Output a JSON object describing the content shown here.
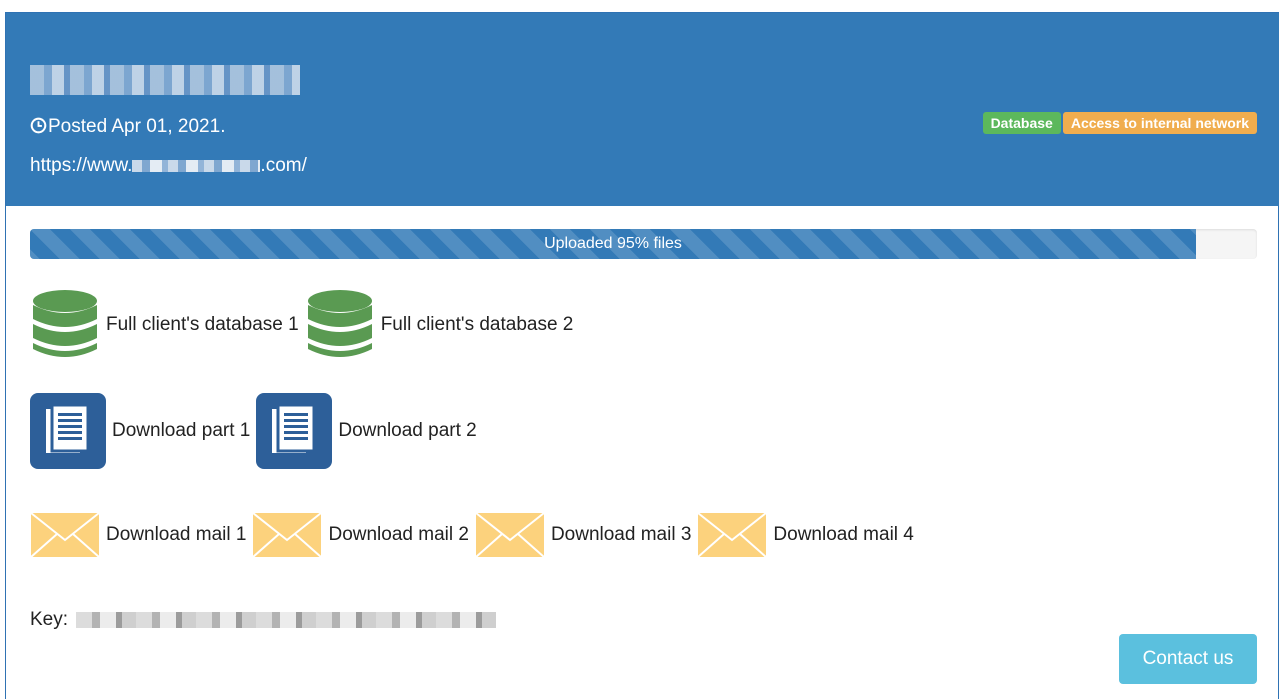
{
  "header": {
    "posted": "Posted Apr 01, 2021.",
    "url_prefix": "https://www.",
    "url_suffix": ".com/",
    "tags": [
      "Database",
      "Access to internal network"
    ],
    "colors": {
      "header_bg": "#337ab7",
      "tag_green": "#5cb85c",
      "tag_orange": "#f0ad4e"
    }
  },
  "progress": {
    "label": "Uploaded 95% files",
    "value_percent": 95
  },
  "databases": [
    {
      "label": "Full client's database 1",
      "icon": "database-icon"
    },
    {
      "label": "Full client's database 2",
      "icon": "database-icon"
    }
  ],
  "downloads": [
    {
      "label": "Download part 1",
      "icon": "document-icon"
    },
    {
      "label": "Download part 2",
      "icon": "document-icon"
    }
  ],
  "mails": [
    {
      "label": "Download mail 1",
      "icon": "mail-icon"
    },
    {
      "label": "Download mail 2",
      "icon": "mail-icon"
    },
    {
      "label": "Download mail 3",
      "icon": "mail-icon"
    },
    {
      "label": "Download mail 4",
      "icon": "mail-icon"
    }
  ],
  "key": {
    "label": "Key:"
  },
  "contact": {
    "label": "Contact us",
    "color": "#5bc0de"
  }
}
